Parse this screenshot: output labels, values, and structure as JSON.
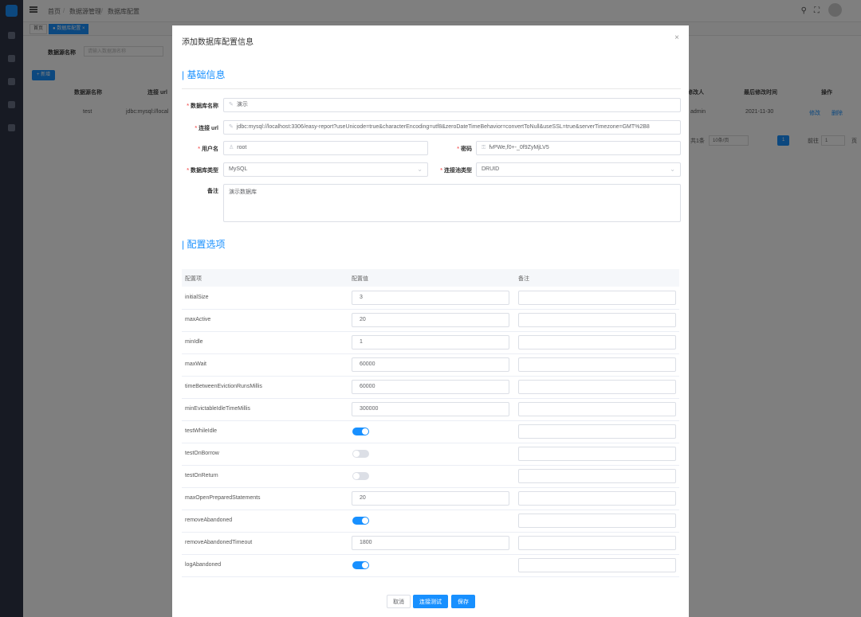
{
  "breadcrumb": {
    "home": "首页",
    "sep": "/",
    "level1": "数据源管理",
    "level2": "数据库配置"
  },
  "tags": {
    "home": "首页",
    "current": "● 数据库配置 ×"
  },
  "background": {
    "search_label": "数据源名称",
    "search_placeholder": "请输入数据源名称",
    "add_button": "+ 新增",
    "columns": [
      "数据源名称",
      "连接 url",
      "修改人",
      "最后修改时间",
      "操作"
    ],
    "row": {
      "name": "test",
      "url": "jdbc:mysql://local",
      "modifier": "admin",
      "time": "2021-11-30",
      "edit": "修改",
      "delete": "删除"
    },
    "pagination": {
      "total": "共1条",
      "page_size": "10条/页",
      "page": "1",
      "goto_label": "前往",
      "goto_value": "1",
      "page_unit": "页"
    }
  },
  "modal": {
    "title": "添加数据库配置信息",
    "close": "×",
    "section_basic": "| 基础信息",
    "section_config": "| 配置选项",
    "fields": {
      "db_name": {
        "label": "数据库名称",
        "value": "演示"
      },
      "url": {
        "label": "连接 url",
        "value": "jdbc:mysql://localhost:3306/easy-report?useUnicode=true&characterEncoding=utf8&zeroDateTimeBehavior=convertToNull&useSSL=true&serverTimezone=GMT%2B8"
      },
      "username": {
        "label": "用户名",
        "value": "root"
      },
      "password": {
        "label": "密码",
        "value": "fvPWe,f0+-_0f9ZyMjLV5"
      },
      "db_type": {
        "label": "数据库类型",
        "value": "MySQL"
      },
      "pool_type": {
        "label": "连接池类型",
        "value": "DRUID"
      },
      "remark": {
        "label": "备注",
        "value": "演示数据库"
      }
    },
    "config_table": {
      "headers": [
        "配置项",
        "配置值",
        "备注"
      ],
      "rows": [
        {
          "name": "initialSize",
          "type": "input",
          "value": "3"
        },
        {
          "name": "maxActive",
          "type": "input",
          "value": "20"
        },
        {
          "name": "minIdle",
          "type": "input",
          "value": "1"
        },
        {
          "name": "maxWait",
          "type": "input",
          "value": "60000"
        },
        {
          "name": "timeBetweenEvictionRunsMillis",
          "type": "input",
          "value": "60000"
        },
        {
          "name": "minEvictableIdleTimeMillis",
          "type": "input",
          "value": "300000"
        },
        {
          "name": "testWhileIdle",
          "type": "switch",
          "on": true
        },
        {
          "name": "testOnBorrow",
          "type": "switch",
          "on": false
        },
        {
          "name": "testOnReturn",
          "type": "switch",
          "on": false
        },
        {
          "name": "maxOpenPreparedStatements",
          "type": "input",
          "value": "20"
        },
        {
          "name": "removeAbandoned",
          "type": "switch",
          "on": true
        },
        {
          "name": "removeAbandonedTimeout",
          "type": "input",
          "value": "1800"
        },
        {
          "name": "logAbandoned",
          "type": "switch",
          "on": true
        }
      ]
    },
    "buttons": {
      "cancel": "取消",
      "test": "连接测试",
      "save": "保存"
    }
  }
}
